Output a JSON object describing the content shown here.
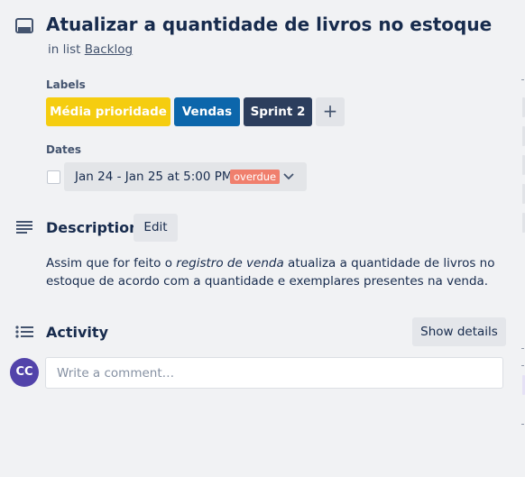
{
  "card": {
    "title": "Atualizar a quantidade de livros no estoque",
    "list_prefix": "in list ",
    "list_name": "Backlog"
  },
  "labels": {
    "heading": "Labels",
    "items": [
      {
        "text": "Média prioridade",
        "color": "#f5cd10"
      },
      {
        "text": "Vendas",
        "color": "#0c66ab"
      },
      {
        "text": "Sprint 2",
        "color": "#2c3e5d"
      }
    ],
    "add_symbol": "+"
  },
  "dates": {
    "heading": "Dates",
    "value": "Jan 24 - Jan 25 at 5:00 PM",
    "badge": "overdue",
    "badge_color": "#f07f6d"
  },
  "description": {
    "heading": "Description",
    "edit_label": "Edit",
    "text_before": "Assim que for feito o ",
    "text_italic": "registro de venda",
    "text_after": " atualiza a quantidade de livros no estoque de acordo com a quantidade e exemplares presentes na venda."
  },
  "activity": {
    "heading": "Activity",
    "show_details_label": "Show details",
    "avatar_initials": "CC",
    "avatar_color": "#5243aa",
    "comment_placeholder": "Write a comment…"
  }
}
